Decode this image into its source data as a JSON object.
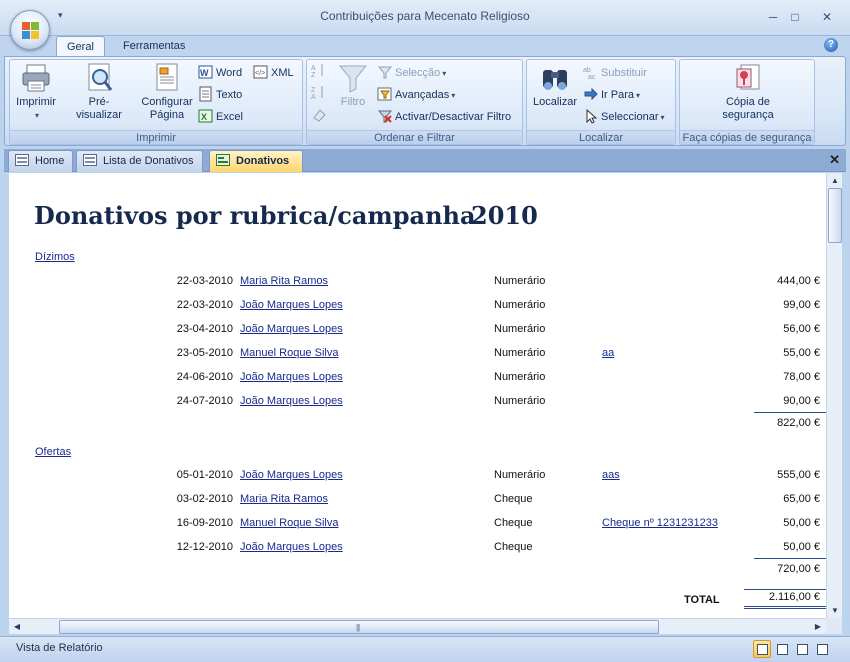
{
  "window": {
    "title": "Contribuições para Mecenato Religioso",
    "minimize": "─",
    "maximize": "□",
    "close": "✕"
  },
  "ribbon_tabs": [
    "Geral",
    "Ferramentas"
  ],
  "ribbon": {
    "imprimir": {
      "label": "Imprimir",
      "print": "Imprimir",
      "preview": "Pré-visualizar",
      "setup_line1": "Configurar",
      "setup_line2": "Página",
      "word": "Word",
      "xml": "XML",
      "text": "Texto",
      "excel": "Excel"
    },
    "ordenar": {
      "label": "Ordenar e Filtrar",
      "filter": "Filtro",
      "selection": "Selecção",
      "advanced": "Avançadas",
      "toggle": "Activar/Desactivar Filtro"
    },
    "localizar": {
      "label": "Localizar",
      "find": "Localizar",
      "replace": "Substituir",
      "goto": "Ir Para",
      "select": "Seleccionar"
    },
    "backup": {
      "label": "Faça cópias de segurança",
      "line1": "Cópia de",
      "line2": "segurança"
    }
  },
  "doc_tabs": [
    {
      "label": "Home"
    },
    {
      "label": "Lista de Donativos"
    },
    {
      "label": "Donativos",
      "active": true
    }
  ],
  "doc_close": "✕",
  "report": {
    "title": "Donativos por rubrica/campanha",
    "year": "2010",
    "groups": [
      {
        "name": "Dízimos",
        "rows": [
          {
            "date": "22-03-2010",
            "name": "Maria Rita Ramos",
            "type": "Numerário",
            "obs": "",
            "value": "444,00 €"
          },
          {
            "date": "22-03-2010",
            "name": "João Marques Lopes",
            "type": "Numerário",
            "obs": "",
            "value": "99,00 €"
          },
          {
            "date": "23-04-2010",
            "name": "João Marques Lopes",
            "type": "Numerário",
            "obs": "",
            "value": "56,00 €"
          },
          {
            "date": "23-05-2010",
            "name": "Manuel Roque Silva",
            "type": "Numerário",
            "obs": "aa",
            "value": "55,00 €"
          },
          {
            "date": "24-06-2010",
            "name": "João Marques Lopes",
            "type": "Numerário",
            "obs": "",
            "value": "78,00 €"
          },
          {
            "date": "24-07-2010",
            "name": "João Marques Lopes",
            "type": "Numerário",
            "obs": "",
            "value": "90,00 €"
          }
        ],
        "subtotal": "822,00 €"
      },
      {
        "name": "Ofertas",
        "rows": [
          {
            "date": "05-01-2010",
            "name": "João Marques Lopes",
            "type": "Numerário",
            "obs": "aas",
            "value": "555,00 €"
          },
          {
            "date": "03-02-2010",
            "name": "Maria Rita Ramos",
            "type": "Cheque",
            "obs": "",
            "value": "65,00 €"
          },
          {
            "date": "16-09-2010",
            "name": "Manuel Roque Silva",
            "type": "Cheque",
            "obs": "Cheque nº 1231231233",
            "value": "50,00 €"
          },
          {
            "date": "12-12-2010",
            "name": "João Marques Lopes",
            "type": "Cheque",
            "obs": "",
            "value": "50,00 €"
          }
        ],
        "subtotal": "720,00 €"
      }
    ],
    "total_label": "TOTAL",
    "total": "2.116,00 €"
  },
  "status": {
    "text": "Vista de Relatório"
  },
  "colors": {
    "accent": "#1a2a8c",
    "active_tab": "#ffd56b",
    "title_text": "#17294d"
  }
}
